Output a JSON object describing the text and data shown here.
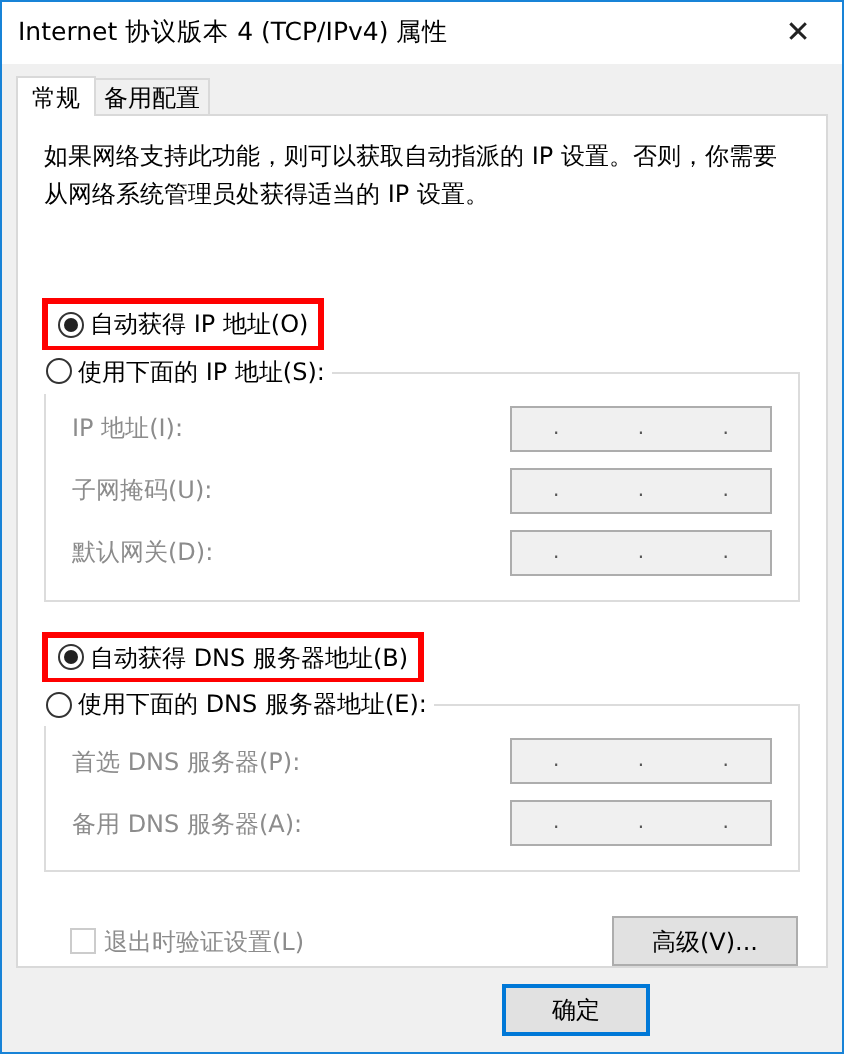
{
  "window": {
    "title": "Internet 协议版本 4 (TCP/IPv4) 属性",
    "close": "✕"
  },
  "tabs": [
    {
      "label": "常规",
      "selected": true
    },
    {
      "label": "备用配置",
      "selected": false
    }
  ],
  "description": "如果网络支持此功能，则可以获取自动指派的 IP 设置。否则，你需要从网络系统管理员处获得适当的 IP 设置。",
  "groups": [
    {
      "auto": {
        "label": "自动获得 IP 地址(O)",
        "selected": true,
        "highlighted": true
      },
      "manual": {
        "label": "使用下面的 IP 地址(S):",
        "selected": false
      },
      "fields": [
        {
          "label": "IP 地址(I):",
          "value": ". . .",
          "disabled": true
        },
        {
          "label": "子网掩码(U):",
          "value": ". . .",
          "disabled": true
        },
        {
          "label": "默认网关(D):",
          "value": ". . .",
          "disabled": true
        }
      ]
    },
    {
      "auto": {
        "label": "自动获得 DNS 服务器地址(B)",
        "selected": true,
        "highlighted": true
      },
      "manual": {
        "label": "使用下面的 DNS 服务器地址(E):",
        "selected": false
      },
      "fields": [
        {
          "label": "首选 DNS 服务器(P):",
          "value": ". . .",
          "disabled": true
        },
        {
          "label": "备用 DNS 服务器(A):",
          "value": ". . .",
          "disabled": true
        }
      ]
    }
  ],
  "validate": {
    "label": "退出时验证设置(L)",
    "checked": false,
    "disabled": true
  },
  "advanced_button": "高级(V)...",
  "buttons": [
    "确定"
  ]
}
